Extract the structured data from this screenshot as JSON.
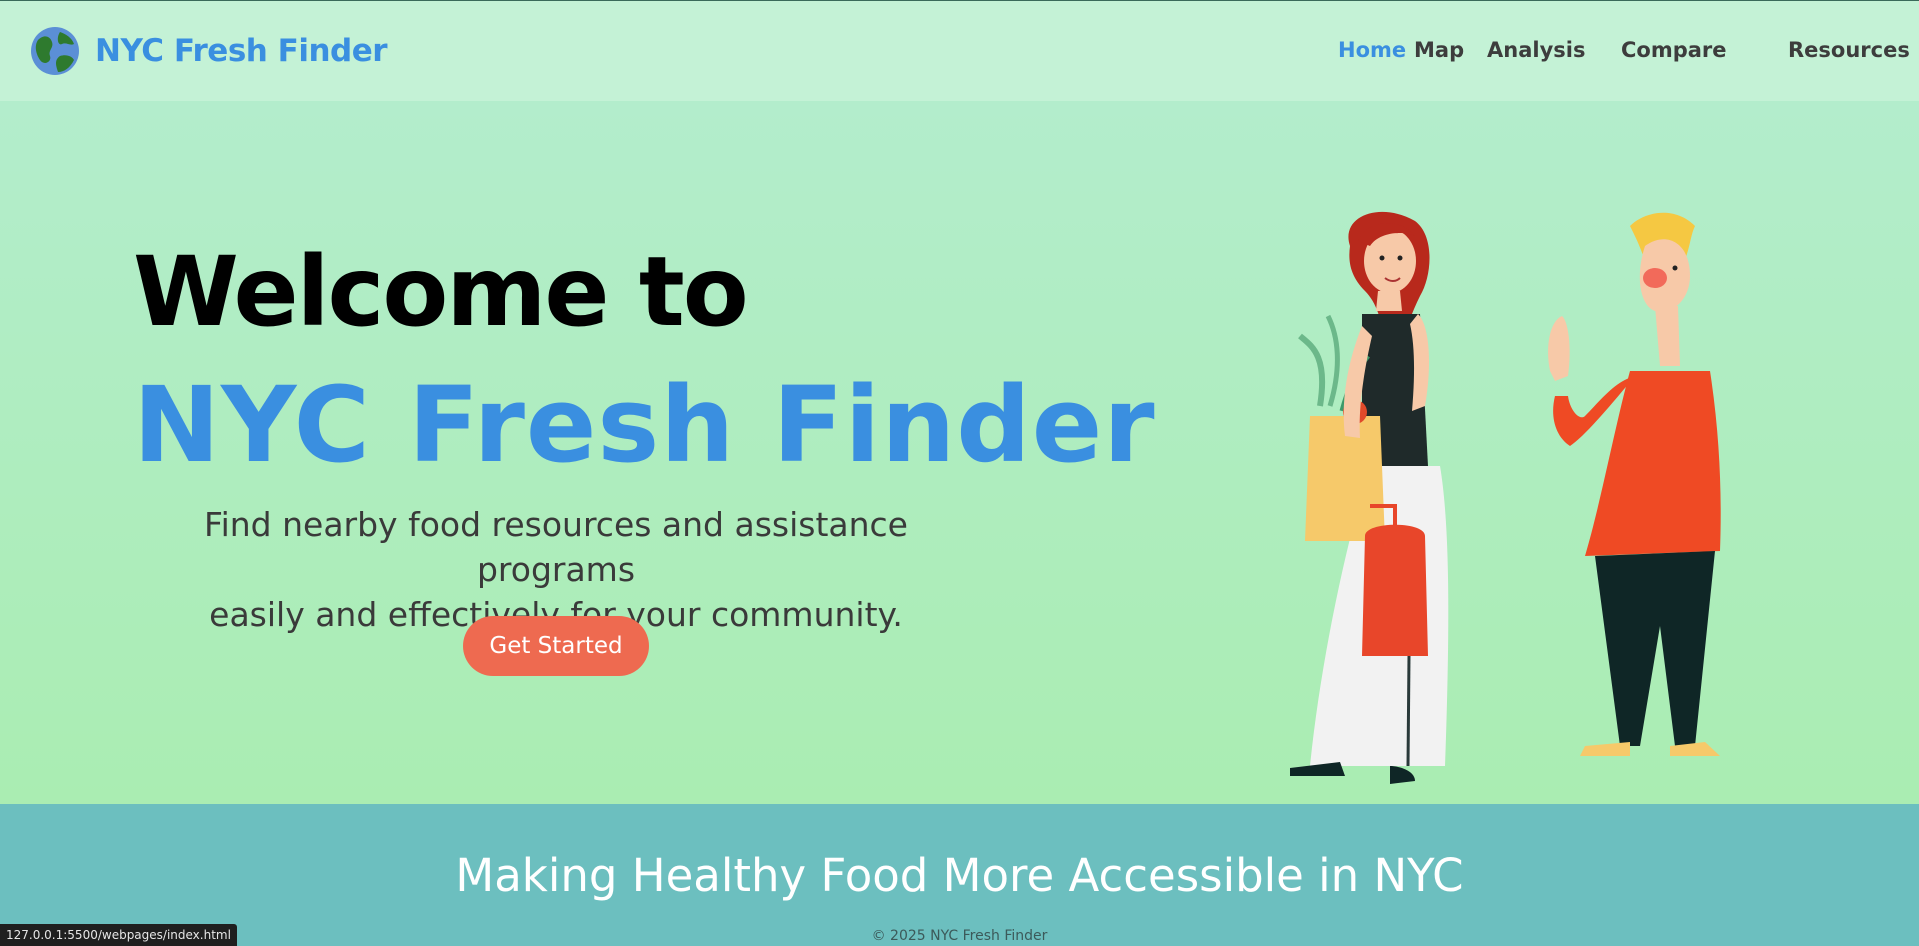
{
  "header": {
    "brand": "NYC Fresh Finder",
    "logo_icon": "globe-icon",
    "nav": [
      {
        "label": "Home",
        "active": true
      },
      {
        "label": "Map",
        "active": false
      },
      {
        "label": "Analysis",
        "active": false
      },
      {
        "label": "Compare",
        "active": false
      },
      {
        "label": "Resources",
        "active": false
      }
    ]
  },
  "hero": {
    "welcome": "Welcome to",
    "title": "NYC Fresh Finder",
    "subtitle_line1": "Find nearby food resources and assistance programs",
    "subtitle_line2": "easily and effectively for your community.",
    "cta": "Get Started",
    "illustration": "people-shopping-illustration"
  },
  "band": {
    "title": "Making Healthy Food More Accessible in NYC",
    "copyright": "© 2025 NYC Fresh Finder"
  },
  "statusbar": {
    "url": "127.0.0.1:5500/webpages/index.html"
  },
  "colors": {
    "accent": "#3a8fe0",
    "cta": "#ee6a50",
    "header_bg": "#c4f2d6",
    "hero_bg": "#aaedb2",
    "band_bg": "#6cbfbf"
  }
}
